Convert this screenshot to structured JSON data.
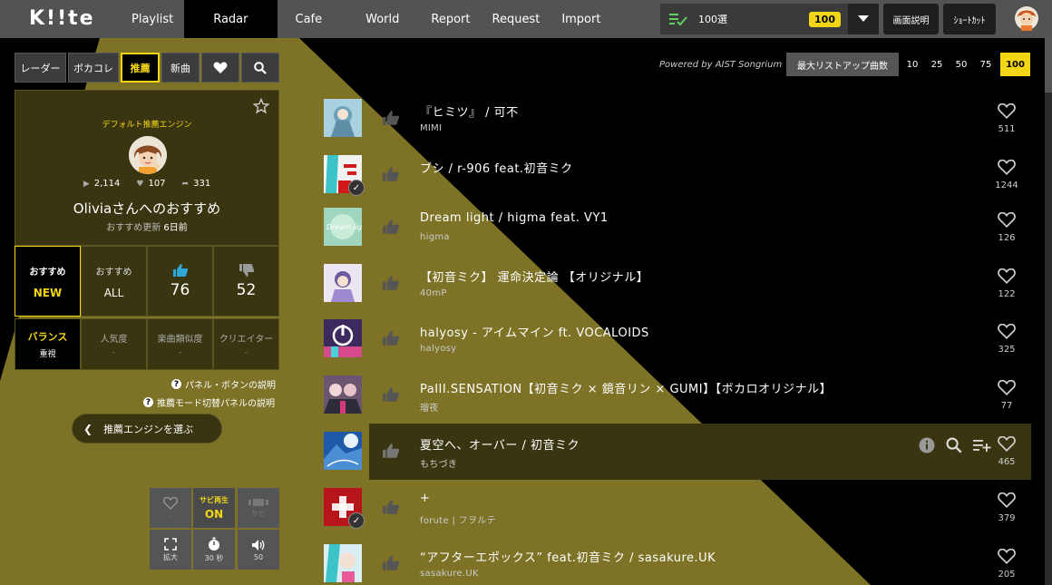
{
  "app": {
    "logo": "K!!te"
  },
  "nav": [
    "Playlist",
    "Radar",
    "Cafe",
    "World",
    "Report",
    "Request",
    "Import"
  ],
  "nav_active": "Radar",
  "header": {
    "playlist_select": "100選",
    "playlist_badge": "100",
    "screen_help": "画面説明",
    "shortcut": "ｼｮｰﾄｶｯﾄ"
  },
  "toolbar": {
    "radar": "レーダー",
    "vocacolle": "ボカコレ",
    "recommend": "推薦",
    "new_songs": "新曲"
  },
  "engine": {
    "title": "デフォルト推薦エンジン",
    "plays": "2,114",
    "likes": "107",
    "comments": "331",
    "name": "Oliviaさんへのおすすめ",
    "update_prefix": "おすすめ更新",
    "update_value": "6日前"
  },
  "modes": [
    {
      "label": "おすすめ",
      "value": "NEW"
    },
    {
      "label": "おすすめ",
      "value": "ALL"
    },
    {
      "count": "76"
    },
    {
      "count": "52"
    }
  ],
  "balance": [
    {
      "label": "バランス",
      "sub": "重視"
    },
    {
      "label": "人気度",
      "sub": "-"
    },
    {
      "label": "楽曲類似度",
      "sub": "-"
    },
    {
      "label": "クリエイター",
      "sub": "-"
    }
  ],
  "help_panel": "パネル・ボタンの説明",
  "help_mode": "推薦モード切替パネルの説明",
  "choose_engine": "推薦エンジンを選ぶ",
  "controls": {
    "sabi_play": "サビ再生",
    "sabi_on": "ON",
    "sabi": "サビ",
    "heart_sub": "-",
    "expand": "拡大",
    "timer": "30 秒",
    "volume": "50"
  },
  "list_header": {
    "powered": "Powered by AIST Songrium",
    "max_list": "最大リストアップ曲数",
    "counts": [
      "10",
      "25",
      "50",
      "75",
      "100"
    ],
    "active_count": "100"
  },
  "songs": [
    {
      "title": "『ヒミツ』 / 可不",
      "artist": "MIMI",
      "likes": "511",
      "thumb_color": "#7fb2c9",
      "checked": false
    },
    {
      "title": "ブシ / r-906 feat.初音ミク",
      "artist": "",
      "likes": "1244",
      "thumb_color": "#e8e8e8",
      "checked": true
    },
    {
      "title": "Dream light / higma feat. VY1",
      "artist": "higma",
      "likes": "126",
      "thumb_color": "#8fc8b5",
      "checked": false
    },
    {
      "title": "【初音ミク】 運命決定論 【オリジナル】",
      "artist": "40mP",
      "likes": "122",
      "thumb_color": "#c9b8de",
      "checked": false
    },
    {
      "title": "halyosy - アイムマイン ft. VOCALOIDS",
      "artist": "halyosy",
      "likes": "325",
      "thumb_color": "#5a4a7a",
      "checked": false
    },
    {
      "title": "PaIII.SENSATION【初音ミク × 鏡音リン × GUMI】【ボカロオリジナル】",
      "artist": "瑠夜",
      "likes": "77",
      "thumb_color": "#8a6e8e",
      "checked": false
    },
    {
      "title": "夏空へ、オーバー / 初音ミク",
      "artist": "もちづき",
      "likes": "465",
      "thumb_color": "#2f6fb8",
      "checked": false
    },
    {
      "title": "+",
      "artist": "forute | フヲルテ",
      "likes": "379",
      "thumb_color": "#b8141c",
      "checked": true
    },
    {
      "title": "“アフターエポックス” feat.初音ミク / sasakure.UK",
      "artist": "sasakure.UK",
      "likes": "205",
      "thumb_color": "#7ab8c4",
      "checked": false
    }
  ],
  "colors": {
    "accent": "#f2d615",
    "beam": "#7d7226"
  }
}
